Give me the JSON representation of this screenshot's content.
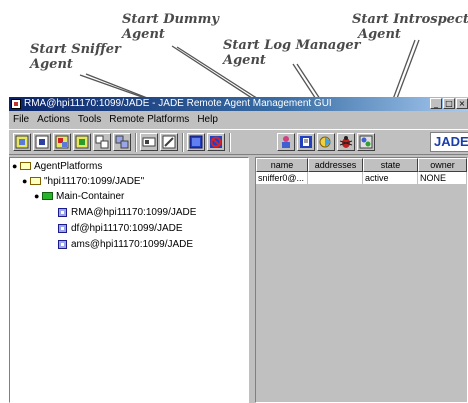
{
  "callouts": {
    "dummy": [
      "Start Dummy",
      "Agent"
    ],
    "introspector": "Start Introspect",
    "introspector2": "Agent",
    "sniffer": [
      "Start Sniffer",
      "Agent"
    ],
    "logmanager": "Start Log Manager",
    "logmanager2": "Agent"
  },
  "window": {
    "title": "RMA@hpi11170:1099/JADE - JADE Remote Agent Management GUI",
    "buttons": {
      "minimize": "_",
      "maximize": "□",
      "close": "×"
    }
  },
  "menu": [
    "File",
    "Actions",
    "Tools",
    "Remote Platforms",
    "Help"
  ],
  "toolbar": {
    "icons": [
      "new-agent-icon",
      "kill-agent-icon",
      "suspend-agent-icon",
      "resume-agent-icon",
      "migrate-agent-icon",
      "clone-agent-icon",
      "save-container-icon",
      "load-agent-icon",
      "remote-platform-icon",
      "stop-icon",
      "dummy-agent-icon",
      "log-manager-icon",
      "sniffer-icon",
      "introspector-icon",
      "configure-icon"
    ],
    "logo": "JADE"
  },
  "tree": {
    "root": "AgentPlatforms",
    "platform": "\"hpi11170:1099/JADE\"",
    "container": "Main-Container",
    "agents": [
      "RMA@hpi11170:1099/JADE",
      "df@hpi11170:1099/JADE",
      "ams@hpi11170:1099/JADE"
    ]
  },
  "table": {
    "columns": [
      "name",
      "addresses",
      "state",
      "owner"
    ],
    "rows": [
      [
        "sniffer0@...",
        "",
        "active",
        "NONE"
      ]
    ]
  },
  "colors": {
    "title_bar": "#0a246a",
    "window_bg": "#c0c0c0",
    "container_folder": "#29b32a"
  }
}
